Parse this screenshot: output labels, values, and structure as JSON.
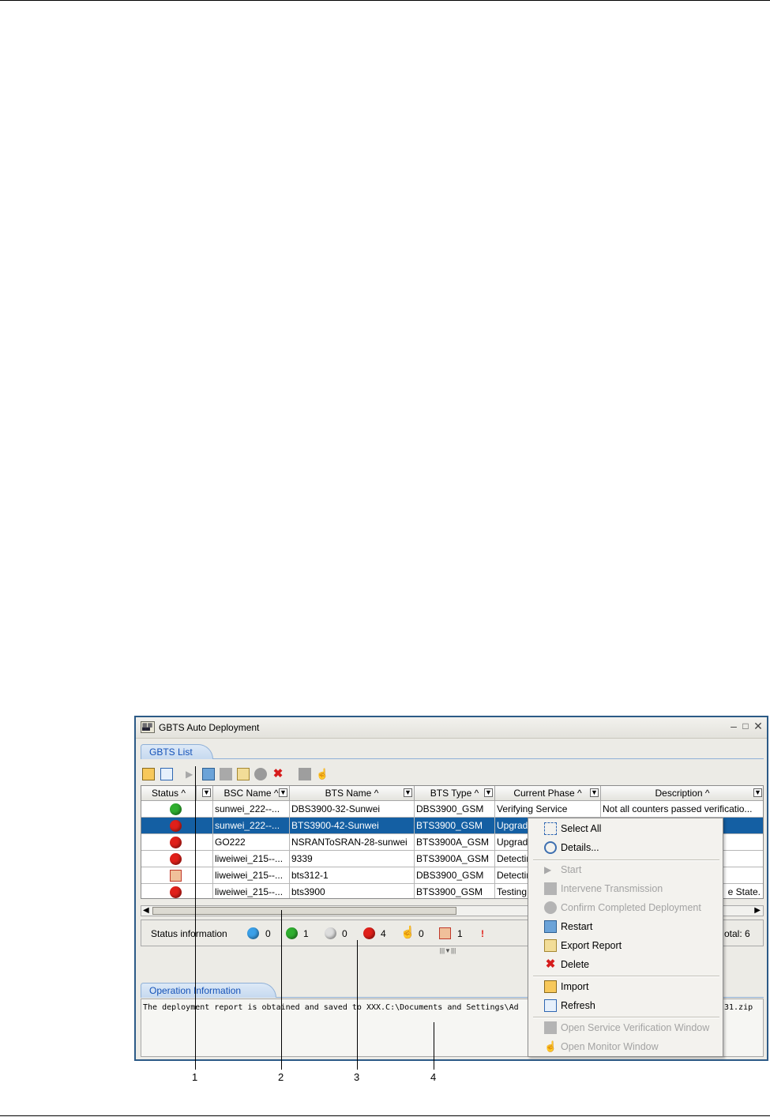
{
  "window": {
    "title": "GBTS Auto Deployment",
    "controls": [
      "–",
      "□",
      "✕"
    ],
    "tab_list": "GBTS List",
    "tab_operation": "Operation Information"
  },
  "table": {
    "columns": [
      "Status",
      "BSC Name",
      "BTS Name",
      "BTS Type",
      "Current Phase",
      "Description"
    ],
    "rows": [
      {
        "status": "green-clock",
        "bsc": "sunwei_222--...",
        "bts": "DBS3900-32-Sunwei",
        "type": "DBS3900_GSM",
        "phase": "Verifying Service",
        "desc": "Not all counters passed verificatio..."
      },
      {
        "status": "red",
        "bsc": "sunwei_222--...",
        "bts": "BTS3900-42-Sunwei",
        "type": "BTS3900_GSM",
        "phase": "Upgrad",
        "desc": ""
      },
      {
        "status": "red",
        "bsc": "GO222",
        "bts": "NSRANToSRAN-28-sunwei",
        "type": "BTS3900A_GSM",
        "phase": "Upgrad",
        "desc": ""
      },
      {
        "status": "red",
        "bsc": "liweiwei_215--...",
        "bts": "9339",
        "type": "BTS3900A_GSM",
        "phase": "Detectir",
        "desc": ""
      },
      {
        "status": "intervene",
        "bsc": "liweiwei_215--...",
        "bts": "bts312-1",
        "type": "DBS3900_GSM",
        "phase": "Detectir",
        "desc": ""
      },
      {
        "status": "red",
        "bsc": "liweiwei_215--...",
        "bts": "bts3900",
        "type": "BTS3900_GSM",
        "phase": "Testing",
        "desc": "e State."
      }
    ]
  },
  "status_info": {
    "label": "Status information",
    "counts": [
      {
        "icon": "blue-circle-icon",
        "color": "#3aa0e8",
        "value": "0"
      },
      {
        "icon": "green-circle-icon",
        "color": "#2fae2f",
        "value": "1"
      },
      {
        "icon": "grey-circle-icon",
        "color": "#dddddd",
        "value": "0"
      },
      {
        "icon": "red-circle-icon",
        "color": "#e0201a",
        "value": "4"
      },
      {
        "icon": "hand-icon",
        "value": "0"
      },
      {
        "icon": "intervene-icon",
        "value": "1"
      },
      {
        "icon": "exclamation-icon",
        "value": "!"
      }
    ],
    "total": "otal:  6"
  },
  "operation_text": "The deployment report is obtained and saved to XXX.C:\\Documents and Settings\\Ad",
  "operation_text_tail": "31.zip",
  "context_menu": [
    {
      "label": "Select All",
      "icon": "select-all-icon",
      "enabled": true
    },
    {
      "label": "Details...",
      "icon": "details-icon",
      "enabled": true
    },
    {
      "label": "Start",
      "icon": "start-icon",
      "enabled": false
    },
    {
      "label": "Intervene Transmission",
      "icon": "intervene-icon",
      "enabled": false
    },
    {
      "label": "Confirm Completed Deployment",
      "icon": "confirm-icon",
      "enabled": false
    },
    {
      "label": "Restart",
      "icon": "restart-icon",
      "enabled": true
    },
    {
      "label": "Export Report",
      "icon": "export-icon",
      "enabled": true
    },
    {
      "label": "Delete",
      "icon": "delete-icon",
      "enabled": true
    },
    {
      "label": "Import",
      "icon": "import-icon",
      "enabled": true
    },
    {
      "label": "Refresh",
      "icon": "refresh-icon",
      "enabled": true
    },
    {
      "label": "Open Service Verification Window",
      "icon": "verify-window-icon",
      "enabled": false
    },
    {
      "label": "Open Monitor Window",
      "icon": "monitor-window-icon",
      "enabled": false
    }
  ],
  "callouts": [
    "1",
    "2",
    "3",
    "4"
  ]
}
